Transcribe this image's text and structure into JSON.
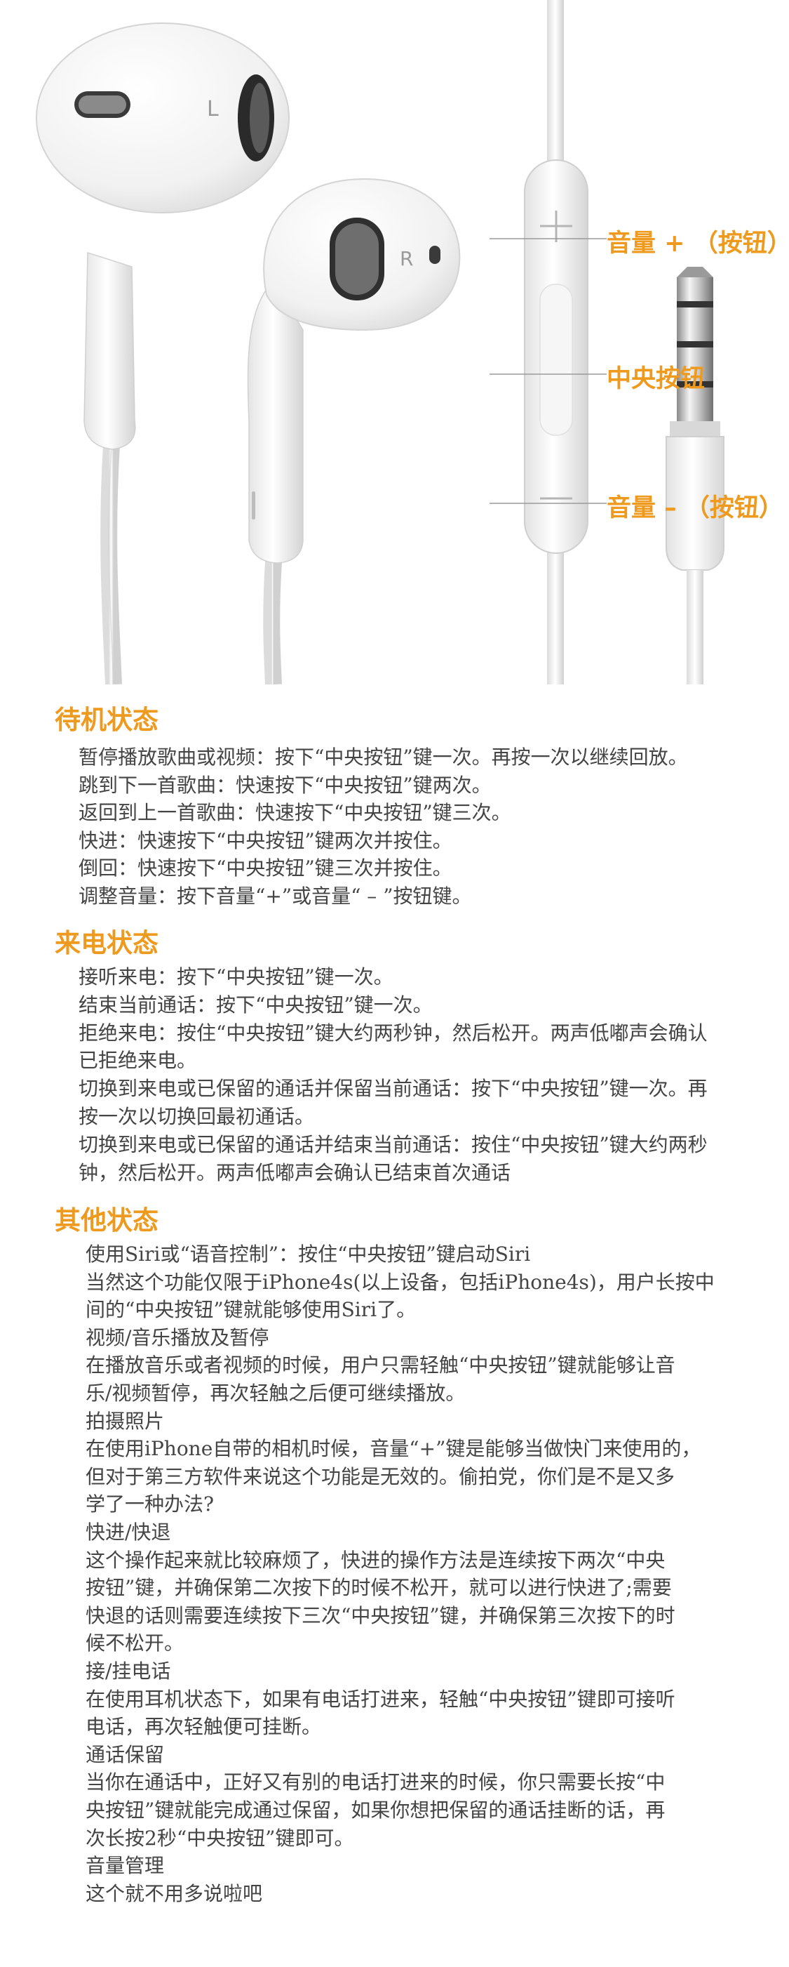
{
  "figure": {
    "left_label": "L",
    "right_label": "R",
    "callouts": {
      "volume_up": "音量 + （按钮）",
      "center": "中央按钮",
      "volume_down": "音量 – （按钮）"
    }
  },
  "sections": [
    {
      "title": "待机状态",
      "lines": [
        "暂停播放歌曲或视频：按下“中央按钮”键一次。再按一次以继续回放。",
        "跳到下一首歌曲：快速按下“中央按钮”键两次。",
        "返回到上一首歌曲：快速按下“中央按钮”键三次。",
        "快进：快速按下“中央按钮”键两次并按住。",
        "倒回：快速按下“中央按钮”键三次并按住。",
        "调整音量：按下音量“+”或音量“ – ”按钮键。"
      ]
    },
    {
      "title": "来电状态",
      "lines": [
        "接听来电：按下“中央按钮”键一次。",
        "结束当前通话：按下“中央按钮”键一次。",
        "拒绝来电：按住“中央按钮”键大约两秒钟，然后松开。两声低嘟声会确认",
        "已拒绝来电。",
        "切换到来电或已保留的通话并保留当前通话：按下“中央按钮”键一次。再",
        "按一次以切换回最初通话。",
        "切换到来电或已保留的通话并结束当前通话：按住“中央按钮”键大约两秒",
        "钟，然后松开。两声低嘟声会确认已结束首次通话"
      ]
    },
    {
      "title": "其他状态",
      "lines": [
        "使用Siri或“语音控制”：按住“中央按钮”键启动Siri",
        "当然这个功能仅限于iPhone4s(以上设备，包括iPhone4s)，用户长按中",
        "间的“中央按钮”键就能够使用Siri了。",
        "视频/音乐播放及暂停",
        "在播放音乐或者视频的时候，用户只需轻触“中央按钮”键就能够让音",
        "乐/视频暂停，再次轻触之后便可继续播放。",
        "拍摄照片",
        "在使用iPhone自带的相机时候，音量“+”键是能够当做快门来使用的，",
        "但对于第三方软件来说这个功能是无效的。偷拍党，你们是不是又多",
        "学了一种办法?",
        "快进/快退",
        "这个操作起来就比较麻烦了，快进的操作方法是连续按下两次“中央",
        "按钮”键，并确保第二次按下的时候不松开，就可以进行快进了;需要",
        "快退的话则需要连续按下三次“中央按钮”键，并确保第三次按下的时",
        "候不松开。",
        "接/挂电话",
        "在使用耳机状态下，如果有电话打进来，轻触“中央按钮”键即可接听",
        "电话，再次轻触便可挂断。",
        "通话保留",
        "当你在通话中，正好又有别的电话打进来的时候，你只需要长按“中",
        "央按钮”键就能完成通过保留，如果你想把保留的通话挂断的话，再",
        "次长按2秒“中央按钮”键即可。",
        "音量管理",
        "这个就不用多说啦吧"
      ]
    }
  ]
}
